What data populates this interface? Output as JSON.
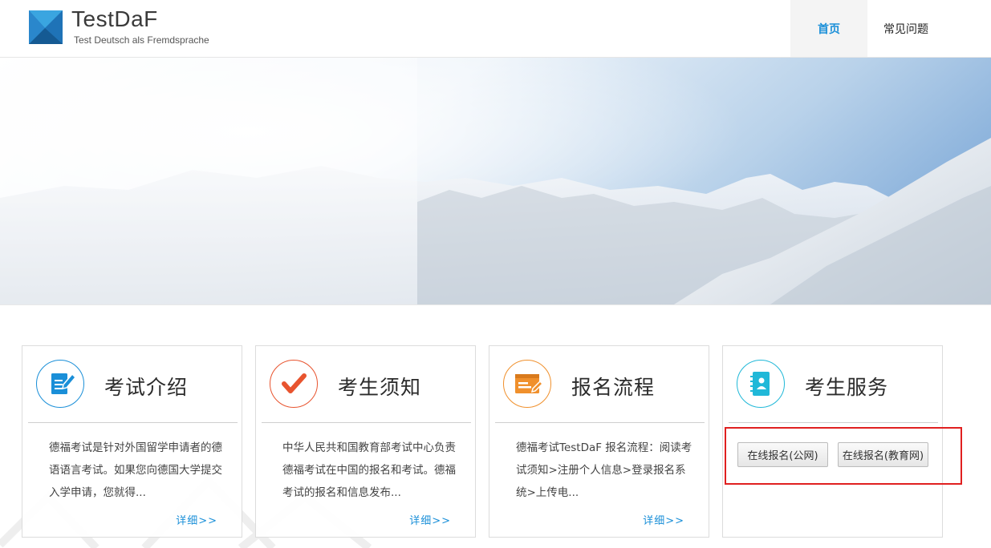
{
  "header": {
    "brand_title": "TestDaF",
    "brand_subtitle": "Test Deutsch als Fremdsprache",
    "nav": {
      "home": "首页",
      "faq": "常见问题"
    }
  },
  "colors": {
    "accent_blue": "#1a8fd8",
    "check_red": "#e8542f",
    "process_orange": "#f0902c",
    "service_cyan": "#20b8d8",
    "highlight_red": "#e02020"
  },
  "cards": [
    {
      "title": "考试介绍",
      "icon": "document-edit-icon",
      "desc": "德福考试是针对外国留学申请者的德语语言考试。如果您向德国大学提交入学申请，您就得...",
      "more": "详细>>"
    },
    {
      "title": "考生须知",
      "icon": "checkmark-icon",
      "desc": "中华人民共和国教育部考试中心负责德福考试在中国的报名和考试。德福考试的报名和信息发布...",
      "more": "详细>>"
    },
    {
      "title": "报名流程",
      "icon": "browser-form-icon",
      "desc": "德福考试TestDaF 报名流程：阅读考试须知>注册个人信息>登录报名系统>上传电...",
      "more": "详细>>"
    },
    {
      "title": "考生服务",
      "icon": "contact-book-icon",
      "buttons": [
        "在线报名(公网)",
        "在线报名(教育网)"
      ]
    }
  ]
}
